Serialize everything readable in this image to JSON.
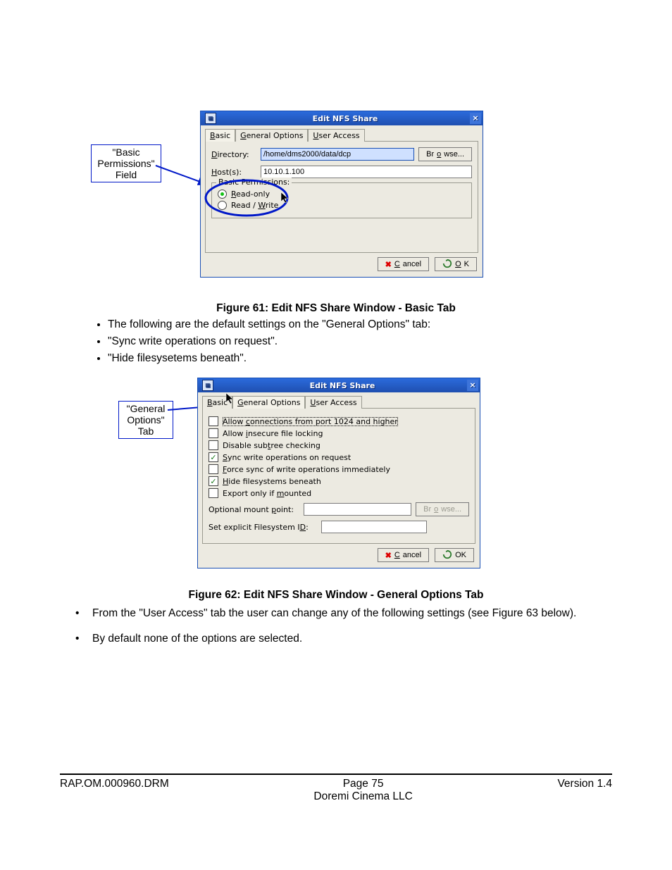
{
  "callouts": {
    "basic_permissions": "\"Basic Permissions\" Field",
    "general_options": "\"General Options\" Tab"
  },
  "figure61": {
    "caption": "Figure 61: Edit NFS Share Window - Basic Tab",
    "window": {
      "title": "Edit NFS Share",
      "tabs": {
        "basic": "Basic",
        "general": "General Options",
        "user": "User Access"
      },
      "directory_label": "Directory:",
      "directory_value": "/home/dms2000/data/dcp",
      "browse": "Browse...",
      "hosts_label": "Host(s):",
      "hosts_value": "10.10.1.100",
      "legend": "Basic Permissions:",
      "radio_read_only": "Read-only",
      "radio_read_write": "Read / Write",
      "cancel": "Cancel",
      "ok": "OK"
    }
  },
  "bullets61": [
    "The following are the default settings on the \"General Options\" tab:",
    "\"Sync write operations on request\".",
    "\"Hide filesysetems beneath\"."
  ],
  "figure62": {
    "caption": "Figure 62: Edit NFS Share Window - General Options Tab",
    "window": {
      "title": "Edit NFS Share",
      "tabs": {
        "basic": "Basic",
        "general": "General Options",
        "user": "User Access"
      },
      "opts": {
        "allow_conn": "Allow connections from port 1024 and higher",
        "allow_insecure": "Allow insecure file locking",
        "disable_subtree": "Disable subtree checking",
        "sync_write": "Sync write operations on request",
        "force_sync": "Force sync of write operations immediately",
        "hide_fs": "Hide filesystems beneath",
        "export_mounted": "Export only if mounted"
      },
      "mount_label": "Optional mount point:",
      "mount_value": "",
      "fsid_label": "Set explicit Filesystem ID:",
      "fsid_value": "",
      "browse": "Browse...",
      "cancel": "Cancel",
      "ok": "OK"
    }
  },
  "bullets62": [
    "From the \"User Access\" tab the user can change any of the following settings (see Figure 63 below).",
    "By default none of the options are selected."
  ],
  "footer": {
    "left": "RAP.OM.000960.DRM",
    "page_prefix": "Page ",
    "page_num": "75",
    "company": "Doremi Cinema LLC",
    "version": "Version 1.4"
  }
}
